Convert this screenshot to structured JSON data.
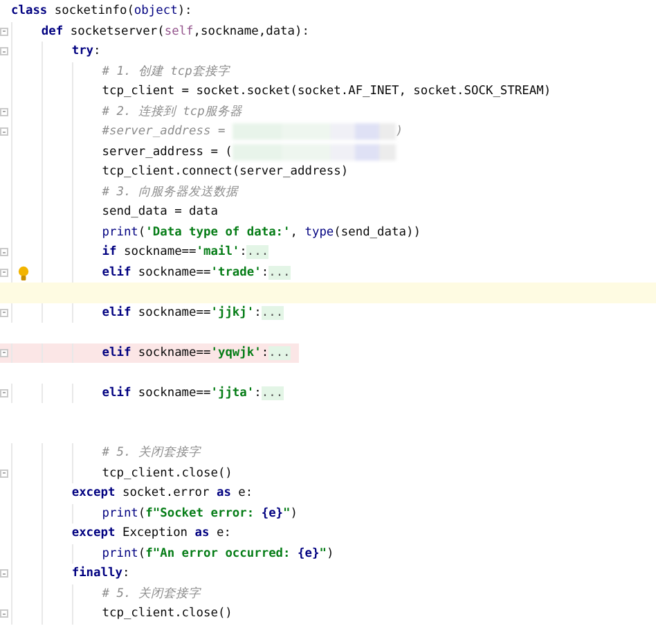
{
  "editor": {
    "lines": [
      {
        "kind": "code",
        "tokens": [
          {
            "kind": "kw",
            "text": "class"
          },
          {
            "kind": "id",
            "text": " socketinfo("
          },
          {
            "kind": "bi",
            "text": "object"
          },
          {
            "kind": "id",
            "text": "):"
          }
        ]
      },
      {
        "kind": "code",
        "fold": true,
        "tokens": [
          {
            "kind": "kw",
            "text": "    def"
          },
          {
            "kind": "id",
            "text": " socketserver("
          },
          {
            "kind": "self",
            "text": "self"
          },
          {
            "kind": "id",
            "text": ",sockname,data):"
          }
        ]
      },
      {
        "kind": "code",
        "fold": true,
        "tokens": [
          {
            "kind": "kw",
            "text": "        try"
          },
          {
            "kind": "id",
            "text": ":"
          }
        ]
      },
      {
        "kind": "code",
        "tokens": [
          {
            "kind": "com",
            "text": "            # 1. 创建 tcp套接字"
          }
        ]
      },
      {
        "kind": "code",
        "tokens": [
          {
            "kind": "id",
            "text": "            tcp_client = socket.socket(socket.AF_INET, socket.SOCK_STREAM)"
          }
        ]
      },
      {
        "kind": "code",
        "fold": true,
        "tokens": [
          {
            "kind": "com",
            "text": "            # 2. 连接到 tcp服务器"
          }
        ]
      },
      {
        "kind": "code",
        "fold": true,
        "tokens": [
          {
            "kind": "com",
            "text": "            #server_address = "
          },
          {
            "kind": "blur"
          },
          {
            "kind": "com",
            "text": ")"
          }
        ]
      },
      {
        "kind": "code",
        "tokens": [
          {
            "kind": "id",
            "text": "            server_address = ("
          },
          {
            "kind": "blur"
          }
        ]
      },
      {
        "kind": "code",
        "tokens": [
          {
            "kind": "id",
            "text": "            tcp_client.connect(server_address)"
          }
        ]
      },
      {
        "kind": "code",
        "tokens": [
          {
            "kind": "com",
            "text": "            # 3. 向服务器发送数据"
          }
        ]
      },
      {
        "kind": "code",
        "tokens": [
          {
            "kind": "id",
            "text": "            send_data = data"
          }
        ]
      },
      {
        "kind": "code",
        "tokens": [
          {
            "kind": "bi",
            "text": "            print"
          },
          {
            "kind": "id",
            "text": "("
          },
          {
            "kind": "str",
            "text": "'Data type of data:'"
          },
          {
            "kind": "id",
            "text": ", "
          },
          {
            "kind": "bi",
            "text": "type"
          },
          {
            "kind": "id",
            "text": "(send_data))"
          }
        ]
      },
      {
        "kind": "code",
        "fold": true,
        "tokens": [
          {
            "kind": "kw",
            "text": "            if"
          },
          {
            "kind": "id",
            "text": " sockname=="
          },
          {
            "kind": "str",
            "text": "'mail'"
          },
          {
            "kind": "id",
            "text": ":"
          },
          {
            "kind": "fold",
            "text": "..."
          }
        ]
      },
      {
        "kind": "code",
        "fold": true,
        "bulb": true,
        "tokens": [
          {
            "kind": "kw",
            "text": "            elif"
          },
          {
            "kind": "id",
            "text": " sockname=="
          },
          {
            "kind": "str",
            "text": "'trade'"
          },
          {
            "kind": "id",
            "text": ":"
          },
          {
            "kind": "fold",
            "text": "..."
          }
        ]
      },
      {
        "kind": "blank",
        "current_line": true
      },
      {
        "kind": "code",
        "fold": true,
        "tokens": [
          {
            "kind": "kw",
            "text": "            elif"
          },
          {
            "kind": "id",
            "text": " sockname=="
          },
          {
            "kind": "str",
            "text": "'jjkj'"
          },
          {
            "kind": "id",
            "text": ":"
          },
          {
            "kind": "fold",
            "text": "..."
          }
        ]
      },
      {
        "kind": "blank"
      },
      {
        "kind": "code",
        "fold": true,
        "error_highlight": true,
        "tokens": [
          {
            "kind": "kw",
            "text": "            elif"
          },
          {
            "kind": "id",
            "text": " sockname=="
          },
          {
            "kind": "str",
            "text": "'yqwjk'"
          },
          {
            "kind": "id",
            "text": ":"
          },
          {
            "kind": "fold",
            "text": "..."
          }
        ]
      },
      {
        "kind": "blank"
      },
      {
        "kind": "code",
        "fold": true,
        "tokens": [
          {
            "kind": "kw",
            "text": "            elif"
          },
          {
            "kind": "id",
            "text": " sockname=="
          },
          {
            "kind": "str",
            "text": "'jjta'"
          },
          {
            "kind": "id",
            "text": ":"
          },
          {
            "kind": "fold",
            "text": "..."
          }
        ]
      },
      {
        "kind": "blank"
      },
      {
        "kind": "blank"
      },
      {
        "kind": "code",
        "tokens": [
          {
            "kind": "com",
            "text": "            # 5. 关闭套接字"
          }
        ]
      },
      {
        "kind": "code",
        "fold": true,
        "tokens": [
          {
            "kind": "id",
            "text": "            tcp_client.close()"
          }
        ]
      },
      {
        "kind": "code",
        "tokens": [
          {
            "kind": "kw",
            "text": "        except"
          },
          {
            "kind": "id",
            "text": " socket.error "
          },
          {
            "kind": "kw",
            "text": "as"
          },
          {
            "kind": "id",
            "text": " e:"
          }
        ]
      },
      {
        "kind": "code",
        "tokens": [
          {
            "kind": "bi",
            "text": "            print"
          },
          {
            "kind": "id",
            "text": "("
          },
          {
            "kind": "str",
            "text": "f\"Socket error: "
          },
          {
            "kind": "kw",
            "text": "{e}"
          },
          {
            "kind": "str",
            "text": "\""
          },
          {
            "kind": "id",
            "text": ")"
          }
        ]
      },
      {
        "kind": "code",
        "tokens": [
          {
            "kind": "kw",
            "text": "        except"
          },
          {
            "kind": "id",
            "text": " Exception "
          },
          {
            "kind": "kw",
            "text": "as"
          },
          {
            "kind": "id",
            "text": " e:"
          }
        ]
      },
      {
        "kind": "code",
        "tokens": [
          {
            "kind": "bi",
            "text": "            print"
          },
          {
            "kind": "id",
            "text": "("
          },
          {
            "kind": "str",
            "text": "f\"An error occurred: "
          },
          {
            "kind": "kw",
            "text": "{e}"
          },
          {
            "kind": "str",
            "text": "\""
          },
          {
            "kind": "id",
            "text": ")"
          }
        ]
      },
      {
        "kind": "code",
        "fold": true,
        "tokens": [
          {
            "kind": "kw",
            "text": "        finally"
          },
          {
            "kind": "id",
            "text": ":"
          }
        ]
      },
      {
        "kind": "code",
        "tokens": [
          {
            "kind": "com",
            "text": "            # 5. 关闭套接字"
          }
        ]
      },
      {
        "kind": "code",
        "fold": true,
        "tokens": [
          {
            "kind": "id",
            "text": "            tcp_client.close()"
          }
        ]
      }
    ]
  }
}
